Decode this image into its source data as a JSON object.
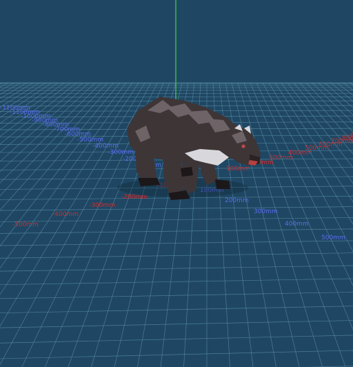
{
  "viewport": {
    "background": "#1f4763",
    "grid_color": "#5c8fa8",
    "axis_y_color": "#3fd63f"
  },
  "model": {
    "name": "bear",
    "body_color": "#3e3537",
    "highlight_color": "#6e6366",
    "chest_color": "#d8d8dc"
  },
  "axes": {
    "positive_x": {
      "color": "#5b6cf0",
      "labels": [
        "100mm",
        "200mm",
        "300mm",
        "400mm",
        "500mm"
      ]
    },
    "negative_x": {
      "color": "#d62a2a",
      "labels": [
        "-100mm",
        "-200mm",
        "-300mm",
        "-400mm",
        "-500mm"
      ]
    },
    "negative_z": {
      "color": "#5b6cf0",
      "labels": [
        "-100mm",
        "-200mm",
        "-300mm",
        "-400mm",
        "-500mm",
        "-600mm",
        "-700mm",
        "-800mm",
        "-900mm",
        "-1000mm",
        "-1100mm",
        "-1200mm"
      ]
    },
    "positive_z": {
      "color": "#d62a2a",
      "labels": [
        "100mm",
        "200mm",
        "300mm",
        "400mm",
        "500mm",
        "600mm",
        "700mm",
        "800mm",
        "900mm",
        "1000mm"
      ]
    }
  }
}
